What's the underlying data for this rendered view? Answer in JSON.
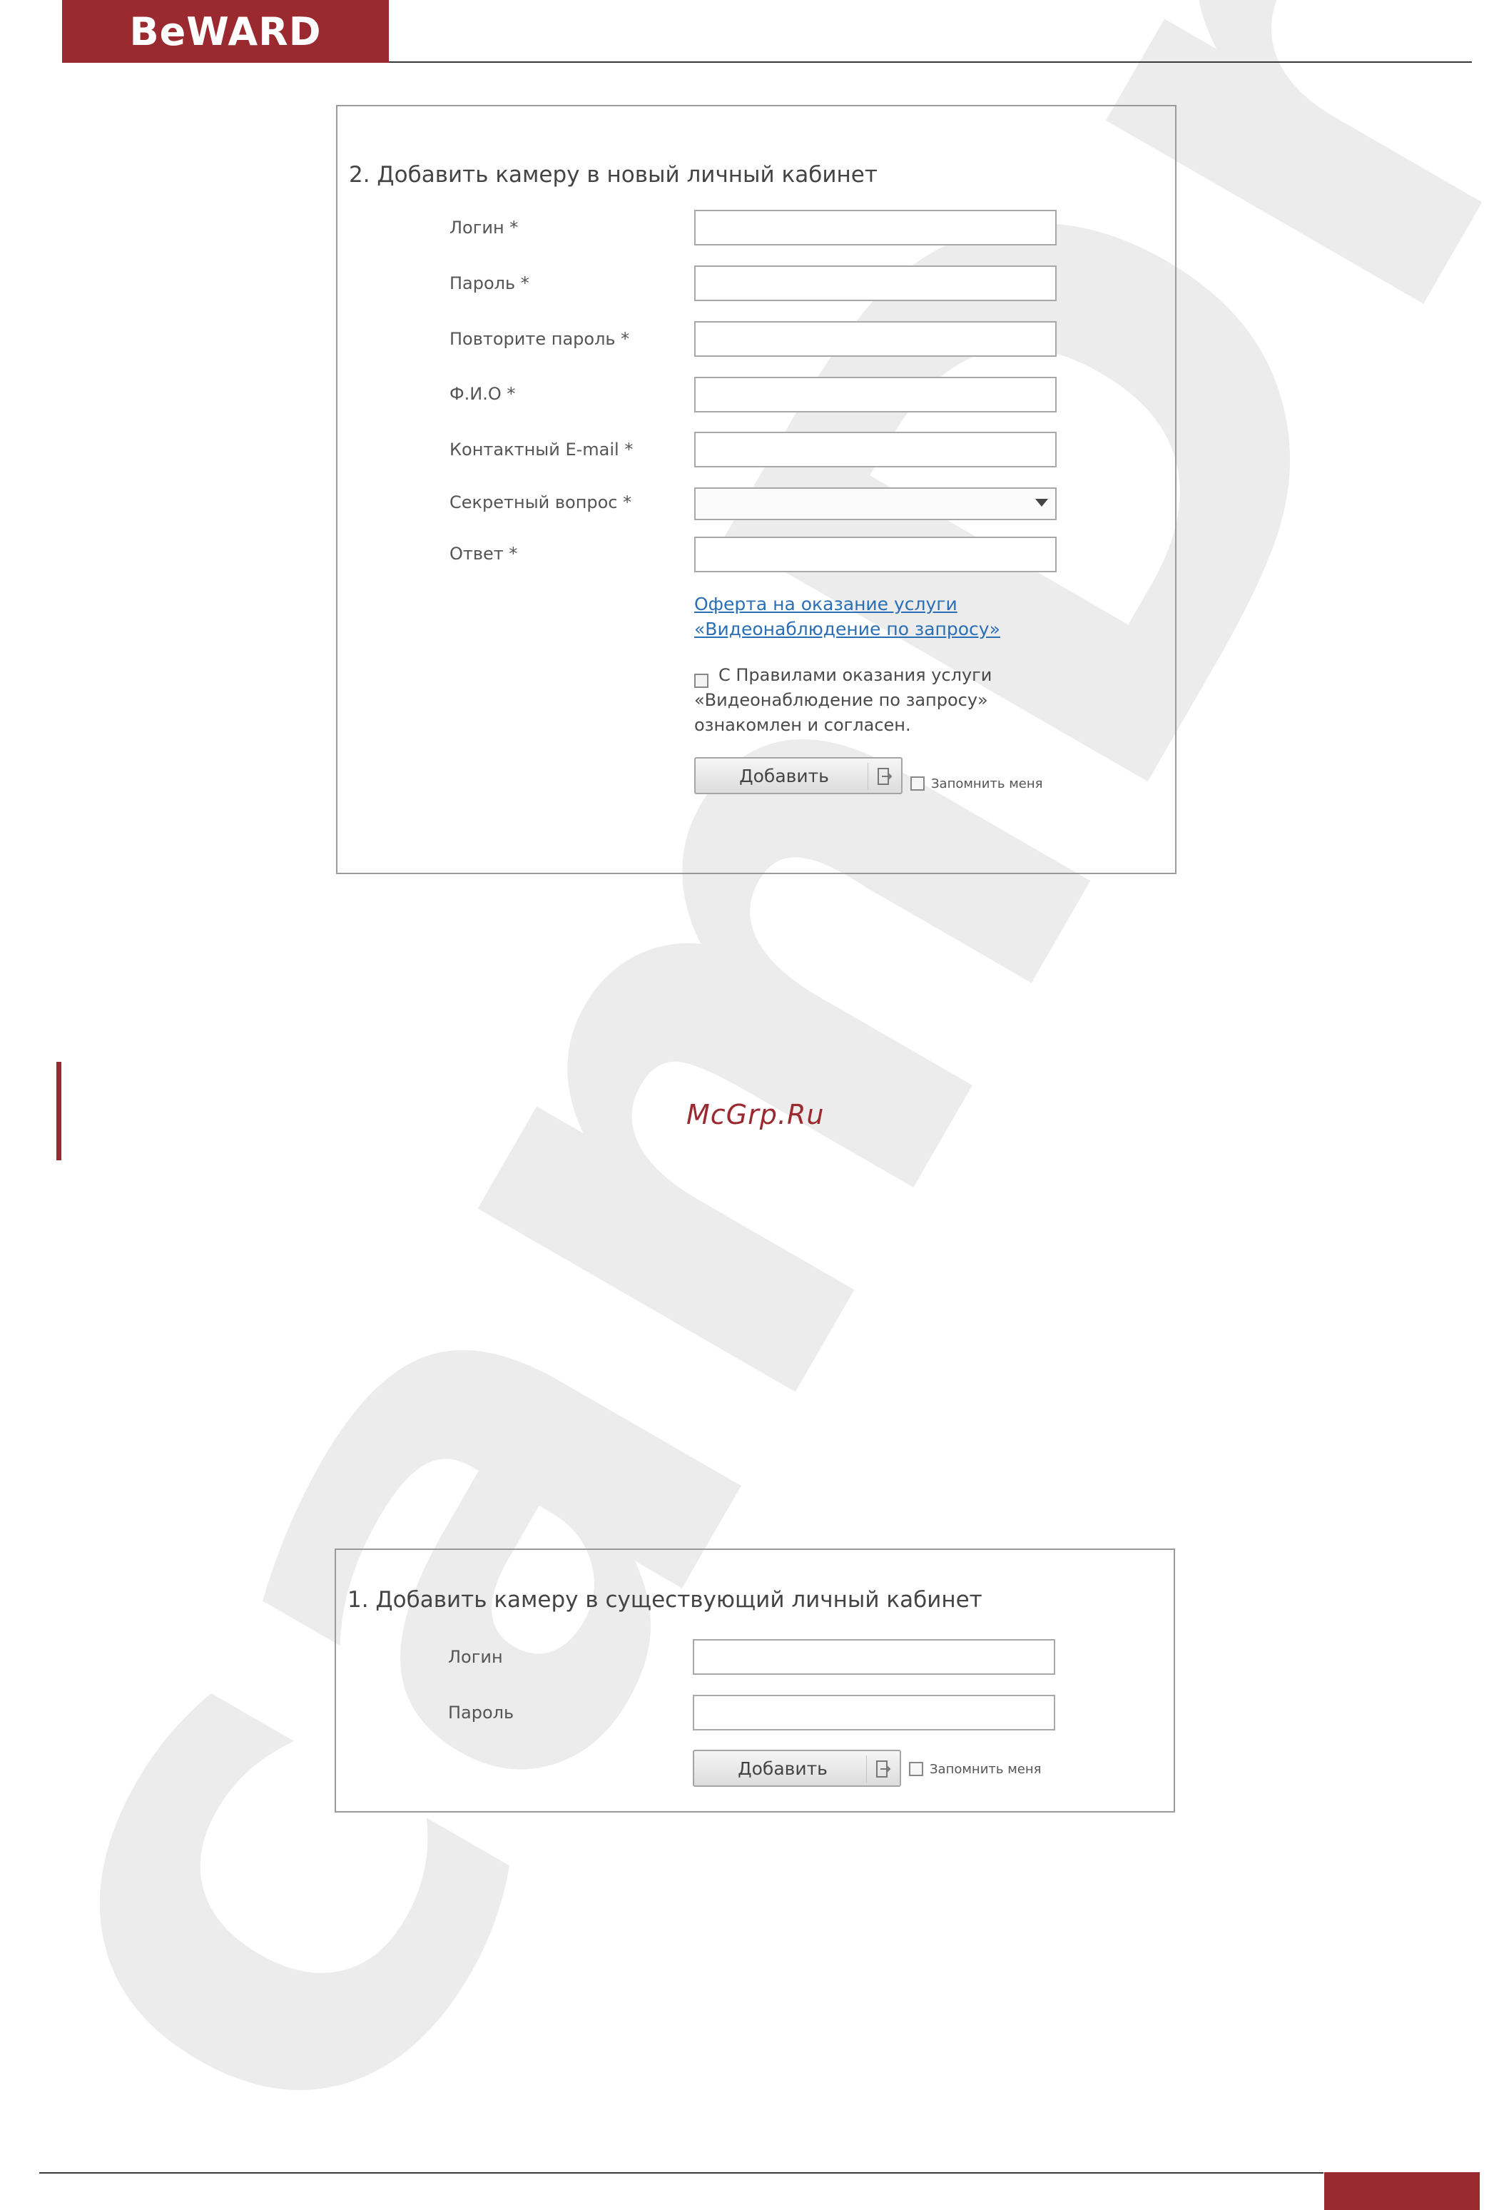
{
  "header": {
    "brand": "BeWARD"
  },
  "watermark": {
    "text": "camDrive"
  },
  "new_account_form": {
    "title": "2. Добавить камеру в новый личный кабинет",
    "fields": [
      {
        "label": "Логин *",
        "value": ""
      },
      {
        "label": "Пароль *",
        "value": ""
      },
      {
        "label": "Повторите пароль *",
        "value": ""
      },
      {
        "label": "Ф.И.О *",
        "value": ""
      },
      {
        "label": "Контактный E-mail *",
        "value": ""
      }
    ],
    "secret_question": {
      "label": "Секретный вопрос *",
      "selected": ""
    },
    "answer": {
      "label": "Ответ *",
      "value": ""
    },
    "offer_link": {
      "line1": "Оферта на оказание услуги",
      "line2": "«Видеонаблюдение по запросу»"
    },
    "agreement": {
      "line1": "С Правилами оказания услуги",
      "line2": "«Видеонаблюдение по запросу»",
      "line3": "ознакомлен и согласен.",
      "checked": false
    },
    "add_button": "Добавить",
    "remember_me": {
      "label": "Запомнить меня",
      "checked": false
    }
  },
  "middle": {
    "site": "McGrp.Ru"
  },
  "existing_account_form": {
    "title": "1. Добавить камеру в существующий личный кабинет",
    "fields": [
      {
        "label": "Логин",
        "value": ""
      },
      {
        "label": "Пароль",
        "value": ""
      }
    ],
    "add_button": "Добавить",
    "remember_me": {
      "label": "Запомнить меня",
      "checked": false
    }
  },
  "colors": {
    "brand": "#9b2a30",
    "link": "#2a6fb5",
    "watermark": "#ececec"
  }
}
